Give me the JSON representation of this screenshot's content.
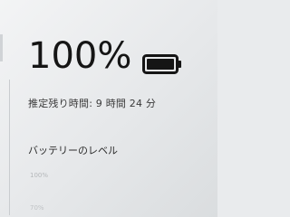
{
  "battery": {
    "percent_text": "100%",
    "charge_level": 1.0,
    "estimate_text": "推定残り時間: 9 時間 24 分"
  },
  "level_section": {
    "title": "バッテリーのレベル",
    "axis_top": "100%",
    "axis_next": "70%"
  },
  "icons": {
    "battery": "battery-full-icon"
  },
  "colors": {
    "text_primary": "#151515",
    "battery_fill": "#151515"
  }
}
